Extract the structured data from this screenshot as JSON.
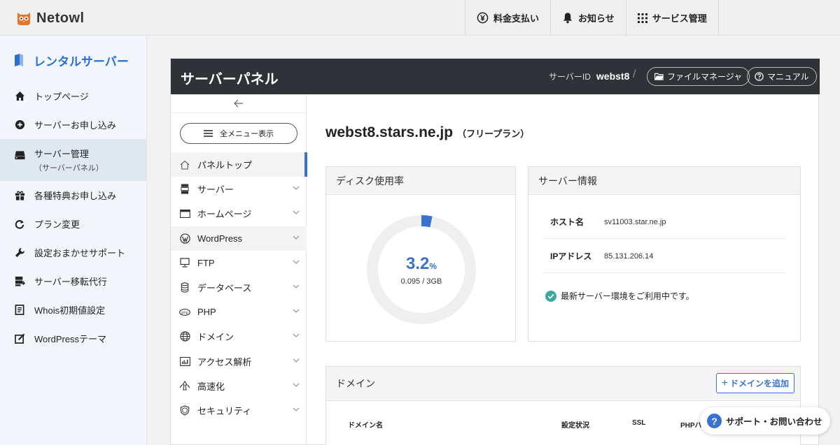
{
  "brand": {
    "name": "Netowl"
  },
  "topnav": [
    {
      "label": "料金支払い",
      "icon": "yen-icon"
    },
    {
      "label": "お知らせ",
      "icon": "bell-icon"
    },
    {
      "label": "サービス管理",
      "icon": "grid-icon"
    }
  ],
  "sidebar": {
    "title": "レンタルサーバー",
    "items": [
      {
        "label": "トップページ",
        "icon": "home-icon"
      },
      {
        "label": "サーバーお申し込み",
        "icon": "plus-circle-icon"
      },
      {
        "label": "サーバー管理",
        "sub": "（サーバーパネル）",
        "icon": "server-icon"
      },
      {
        "label": "各種特典お申し込み",
        "icon": "gift-icon"
      },
      {
        "label": "プラン変更",
        "icon": "refresh-icon"
      },
      {
        "label": "設定おまかせサポート",
        "icon": "wrench-icon"
      },
      {
        "label": "サーバー移転代行",
        "icon": "transfer-icon"
      },
      {
        "label": "Whois初期値設定",
        "icon": "document-icon"
      },
      {
        "label": "WordPressテーマ",
        "icon": "edit-icon"
      }
    ]
  },
  "panel": {
    "title": "サーバーパネル",
    "server_id_label": "サーバーID",
    "server_id": "webst8",
    "separator": "/",
    "file_manager": "ファイルマネージャ",
    "manual": "マニュアル"
  },
  "submenu": {
    "all_menu": "全メニュー表示",
    "items": [
      {
        "label": "パネルトップ",
        "icon": "home-outline-icon"
      },
      {
        "label": "サーバー",
        "icon": "server-stack-icon"
      },
      {
        "label": "ホームページ",
        "icon": "browser-icon"
      },
      {
        "label": "WordPress",
        "icon": "wordpress-icon"
      },
      {
        "label": "FTP",
        "icon": "monitor-icon"
      },
      {
        "label": "データベース",
        "icon": "database-icon"
      },
      {
        "label": "PHP",
        "icon": "php-icon"
      },
      {
        "label": "ドメイン",
        "icon": "globe-icon"
      },
      {
        "label": "アクセス解析",
        "icon": "bar-chart-icon"
      },
      {
        "label": "高速化",
        "icon": "speed-icon"
      },
      {
        "label": "セキュリティ",
        "icon": "shield-icon"
      }
    ]
  },
  "main": {
    "domain": "webst8.stars.ne.jp",
    "plan": "（フリープラン）",
    "disk": {
      "title": "ディスク使用率",
      "percent": "3.2",
      "percent_unit": "%",
      "usage": "0.095 / 3GB",
      "fraction": 0.032
    },
    "server_info": {
      "title": "サーバー情報",
      "host_label": "ホスト名",
      "host": "sv11003.star.ne.jp",
      "ip_label": "IPアドレス",
      "ip": "85.131.206.14",
      "status": "最新サーバー環境をご利用中です。"
    },
    "domains": {
      "title": "ドメイン",
      "add_label": "ドメインを追加",
      "columns": [
        "ドメイン名",
        "設定状況",
        "SSL",
        "PHPバ"
      ]
    }
  },
  "support": {
    "label": "サポート・お問い合わせ"
  },
  "colors": {
    "accent": "#3a72d0",
    "panel_header": "#2f3338",
    "success": "#3aa89a"
  }
}
